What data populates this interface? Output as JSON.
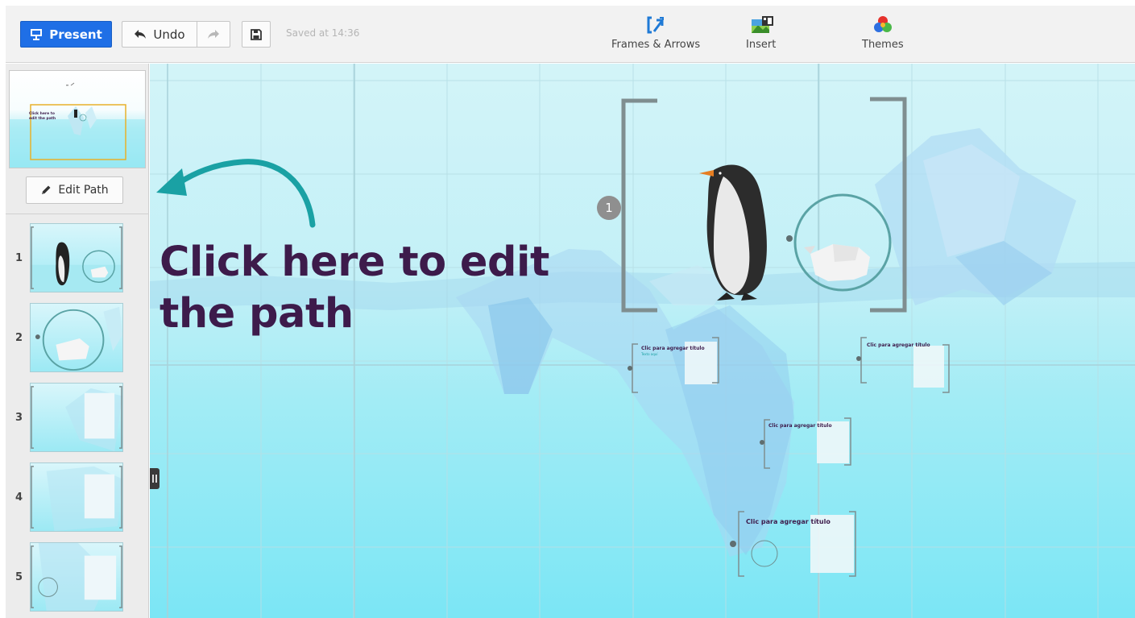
{
  "toolbar": {
    "present_label": "Present",
    "undo_label": "Undo",
    "saved_status": "Saved at 14:36",
    "tools": [
      {
        "label": "Frames & Arrows",
        "icon": "frames-arrows-icon"
      },
      {
        "label": "Insert",
        "icon": "insert-image-icon"
      },
      {
        "label": "Themes",
        "icon": "themes-icon"
      }
    ],
    "accent_color": "#1f6fe6"
  },
  "sidebar": {
    "overview_text": "Click here to edit the path",
    "edit_path_label": "Edit Path",
    "slides": [
      {
        "number": "1"
      },
      {
        "number": "2"
      },
      {
        "number": "3"
      },
      {
        "number": "4"
      },
      {
        "number": "5"
      }
    ]
  },
  "canvas": {
    "headline_line1": "Click here to edit",
    "headline_line2": "the path",
    "step_badge": "1",
    "placeholder_title": "Clic para agregar título",
    "placeholder_body": "Texto aquí",
    "headline_color": "#3d1b4b",
    "arrow_color": "#1aa1a4"
  }
}
